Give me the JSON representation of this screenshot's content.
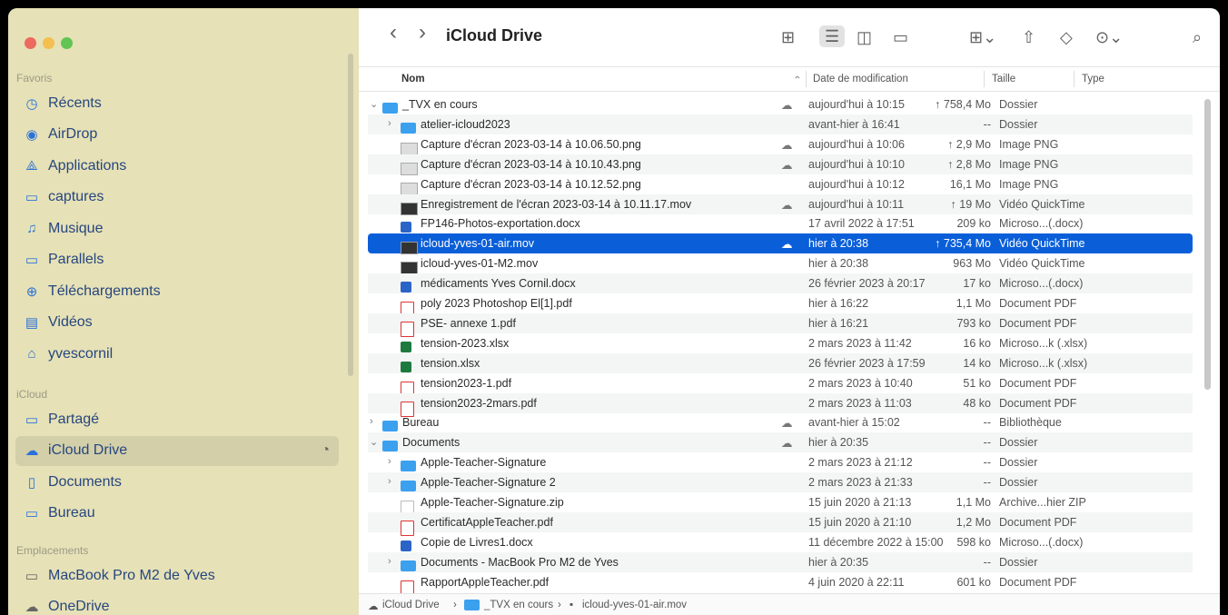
{
  "window": {
    "traffic_lights": [
      "#ed6a5e",
      "#f4bf4f",
      "#61c454"
    ]
  },
  "sidebar": {
    "sections": {
      "favorites": "Favoris",
      "icloud": "iCloud",
      "locations": "Emplacements"
    },
    "favorites": [
      {
        "label": "Récents",
        "icon": "clock-icon",
        "glyph": "◷"
      },
      {
        "label": "AirDrop",
        "icon": "airdrop-icon",
        "glyph": "◉"
      },
      {
        "label": "Applications",
        "icon": "applications-icon",
        "glyph": "⟁"
      },
      {
        "label": "captures",
        "icon": "folder-icon",
        "glyph": "▭"
      },
      {
        "label": "Musique",
        "icon": "music-icon",
        "glyph": "♫"
      },
      {
        "label": "Parallels",
        "icon": "folder-icon",
        "glyph": "▭"
      },
      {
        "label": "Téléchargements",
        "icon": "download-icon",
        "glyph": "⊕"
      },
      {
        "label": "Vidéos",
        "icon": "film-icon",
        "glyph": "▤"
      },
      {
        "label": "yvescornil",
        "icon": "home-icon",
        "glyph": "⌂"
      }
    ],
    "icloud": [
      {
        "label": "Partagé",
        "icon": "shared-folder-icon",
        "glyph": "▭"
      },
      {
        "label": "iCloud Drive",
        "icon": "cloud-icon",
        "glyph": "☁"
      },
      {
        "label": "Documents",
        "icon": "document-icon",
        "glyph": "▯"
      },
      {
        "label": "Bureau",
        "icon": "desktop-icon",
        "glyph": "▭"
      }
    ],
    "locations": [
      {
        "label": "MacBook Pro M2 de Yves",
        "icon": "laptop-icon",
        "glyph": "▭"
      },
      {
        "label": "OneDrive",
        "icon": "cloud-icon",
        "glyph": "☁"
      }
    ]
  },
  "toolbar": {
    "title": "iCloud Drive",
    "back": "‹",
    "forward": "›"
  },
  "list": {
    "headers": {
      "name": "Nom",
      "date": "Date de modification",
      "size": "Taille",
      "type": "Type"
    },
    "rows": [
      {
        "name": "_TVX en cours",
        "kind": "folder",
        "disclosure": "⌄",
        "cloud": "☁",
        "date": "aujourd'hui à 10:15",
        "size": "↑ 758,4 Mo",
        "type": "Dossier"
      },
      {
        "name": "atelier-icloud2023",
        "kind": "folder",
        "disclosure": "›",
        "cloud": "",
        "date": "avant-hier à 16:41",
        "size": "--",
        "type": "Dossier"
      },
      {
        "name": "Capture d'écran 2023-03-14 à 10.06.50.png",
        "kind": "image",
        "disclosure": "",
        "cloud": "☁",
        "date": "aujourd'hui à 10:06",
        "size": "↑ 2,9 Mo",
        "type": "Image PNG"
      },
      {
        "name": "Capture d'écran 2023-03-14 à 10.10.43.png",
        "kind": "image",
        "disclosure": "",
        "cloud": "☁",
        "date": "aujourd'hui à 10:10",
        "size": "↑ 2,8 Mo",
        "type": "Image PNG"
      },
      {
        "name": "Capture d'écran 2023-03-14 à 10.12.52.png",
        "kind": "image",
        "disclosure": "",
        "cloud": "",
        "date": "aujourd'hui à 10:12",
        "size": "16,1 Mo",
        "type": "Image PNG"
      },
      {
        "name": "Enregistrement de l'écran 2023-03-14 à 10.11.17.mov",
        "kind": "video",
        "disclosure": "",
        "cloud": "☁",
        "date": "aujourd'hui à 10:11",
        "size": "↑ 19 Mo",
        "type": "Vidéo QuickTime"
      },
      {
        "name": "FP146-Photos-exportation.docx",
        "kind": "word",
        "disclosure": "",
        "cloud": "",
        "date": "17 avril 2022 à 17:51",
        "size": "209 ko",
        "type": "Microso...(.docx)"
      },
      {
        "name": "icloud-yves-01-air.mov",
        "kind": "video",
        "disclosure": "",
        "cloud": "☁",
        "date": "hier à 20:38",
        "size": "↑ 735,4 Mo",
        "type": "Vidéo QuickTime",
        "selected": true
      },
      {
        "name": "icloud-yves-01-M2.mov",
        "kind": "video",
        "disclosure": "",
        "cloud": "",
        "date": "hier à 20:38",
        "size": "963 Mo",
        "type": "Vidéo QuickTime"
      },
      {
        "name": "médicaments Yves Cornil.docx",
        "kind": "word",
        "disclosure": "",
        "cloud": "",
        "date": "26 février 2023 à 20:17",
        "size": "17 ko",
        "type": "Microso...(.docx)"
      },
      {
        "name": "poly 2023 Photoshop El[1].pdf",
        "kind": "pdf",
        "disclosure": "",
        "cloud": "",
        "date": "hier à 16:22",
        "size": "1,1 Mo",
        "type": "Document PDF"
      },
      {
        "name": "PSE- annexe 1.pdf",
        "kind": "pdf",
        "disclosure": "",
        "cloud": "",
        "date": "hier à 16:21",
        "size": "793 ko",
        "type": "Document PDF"
      },
      {
        "name": "tension-2023.xlsx",
        "kind": "excel",
        "disclosure": "",
        "cloud": "",
        "date": "2 mars 2023 à 11:42",
        "size": "16 ko",
        "type": "Microso...k (.xlsx)"
      },
      {
        "name": "tension.xlsx",
        "kind": "excel",
        "disclosure": "",
        "cloud": "",
        "date": "26 février 2023 à 17:59",
        "size": "14 ko",
        "type": "Microso...k (.xlsx)"
      },
      {
        "name": "tension2023-1.pdf",
        "kind": "pdf",
        "disclosure": "",
        "cloud": "",
        "date": "2 mars 2023 à 10:40",
        "size": "51 ko",
        "type": "Document PDF"
      },
      {
        "name": "tension2023-2mars.pdf",
        "kind": "pdf",
        "disclosure": "",
        "cloud": "",
        "date": "2 mars 2023 à 11:03",
        "size": "48 ko",
        "type": "Document PDF"
      },
      {
        "name": "Bureau",
        "kind": "folder",
        "disclosure": "›",
        "cloud": "☁",
        "date": "avant-hier à 15:02",
        "size": "--",
        "type": "Bibliothèque",
        "level": 0
      },
      {
        "name": "Documents",
        "kind": "folder",
        "disclosure": "⌄",
        "cloud": "☁",
        "date": "hier à 20:35",
        "size": "--",
        "type": "Dossier",
        "level": 0
      },
      {
        "name": "Apple-Teacher-Signature",
        "kind": "folder",
        "disclosure": "›",
        "cloud": "",
        "date": "2 mars 2023 à 21:12",
        "size": "--",
        "type": "Dossier"
      },
      {
        "name": "Apple-Teacher-Signature 2",
        "kind": "folder",
        "disclosure": "›",
        "cloud": "",
        "date": "2 mars 2023 à 21:33",
        "size": "--",
        "type": "Dossier"
      },
      {
        "name": "Apple-Teacher-Signature.zip",
        "kind": "zip",
        "disclosure": "",
        "cloud": "",
        "date": "15 juin 2020 à 21:13",
        "size": "1,1 Mo",
        "type": "Archive...hier ZIP"
      },
      {
        "name": "CertificatAppleTeacher.pdf",
        "kind": "pdf",
        "disclosure": "",
        "cloud": "",
        "date": "15 juin 2020 à 21:10",
        "size": "1,2 Mo",
        "type": "Document PDF"
      },
      {
        "name": "Copie de Livres1.docx",
        "kind": "word",
        "disclosure": "",
        "cloud": "",
        "date": "11 décembre 2022 à 15:00",
        "size": "598 ko",
        "type": "Microso...(.docx)"
      },
      {
        "name": "Documents - MacBook Pro M2 de Yves",
        "kind": "folder",
        "disclosure": "›",
        "cloud": "",
        "date": "hier à 20:35",
        "size": "--",
        "type": "Dossier"
      },
      {
        "name": "RapportAppleTeacher.pdf",
        "kind": "pdf",
        "disclosure": "",
        "cloud": "",
        "date": "4 juin 2020 à 22:11",
        "size": "601 ko",
        "type": "Document PDF"
      }
    ]
  },
  "pathbar": [
    "iCloud Drive",
    "_TVX en cours",
    "icloud-yves-01-air.mov"
  ],
  "pathbar_sep": "›",
  "accent": "#0a5fd9"
}
